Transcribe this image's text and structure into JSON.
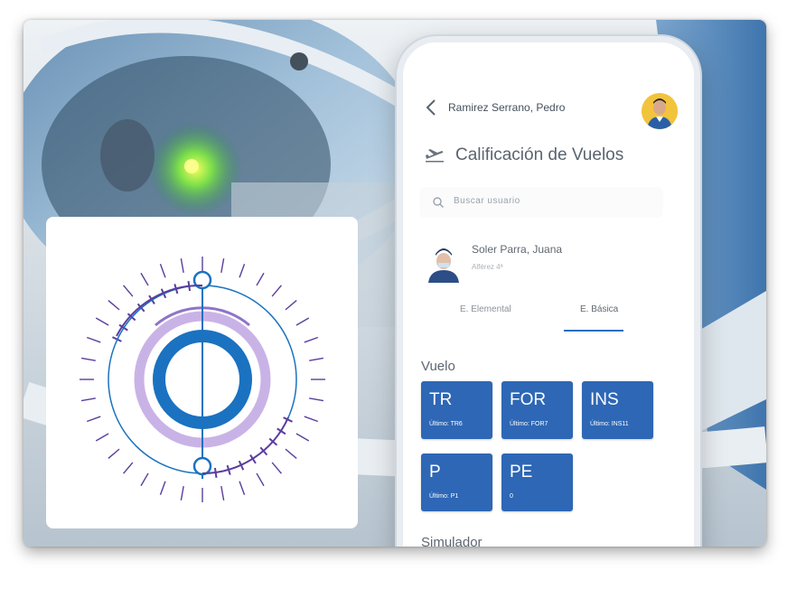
{
  "header": {
    "user_name": "Ramirez Serrano, Pedro"
  },
  "page": {
    "title": "Calificación de Vuelos"
  },
  "search": {
    "placeholder": "Buscar usuario"
  },
  "student": {
    "name": "Soler Parra, Juana",
    "rank": "Alférez 4ª",
    "subtitle": ""
  },
  "tabs": [
    {
      "label": "E. Elemental",
      "active": false
    },
    {
      "label": "E. Básica",
      "active": true
    }
  ],
  "sections": {
    "vuelo": "Vuelo",
    "simulador": "Simulador"
  },
  "tiles": [
    {
      "code": "TR",
      "last": "Último: TR6"
    },
    {
      "code": "FOR",
      "last": "Último: FOR7"
    },
    {
      "code": "INS",
      "last": "Último: INS11"
    },
    {
      "code": "P",
      "last": "Último: P1"
    },
    {
      "code": "PE",
      "last": "0"
    }
  ],
  "colors": {
    "tile_blue": "#2e67b5",
    "logo_blue": "#1a72c0",
    "logo_lavender": "#c9b3e6",
    "logo_purple": "#5b3d9e",
    "avatar_yellow": "#f2c33c"
  },
  "icons": [
    "back-chevron-icon",
    "airplane-takeoff-icon",
    "search-icon",
    "user-avatar",
    "logo-emblem"
  ]
}
